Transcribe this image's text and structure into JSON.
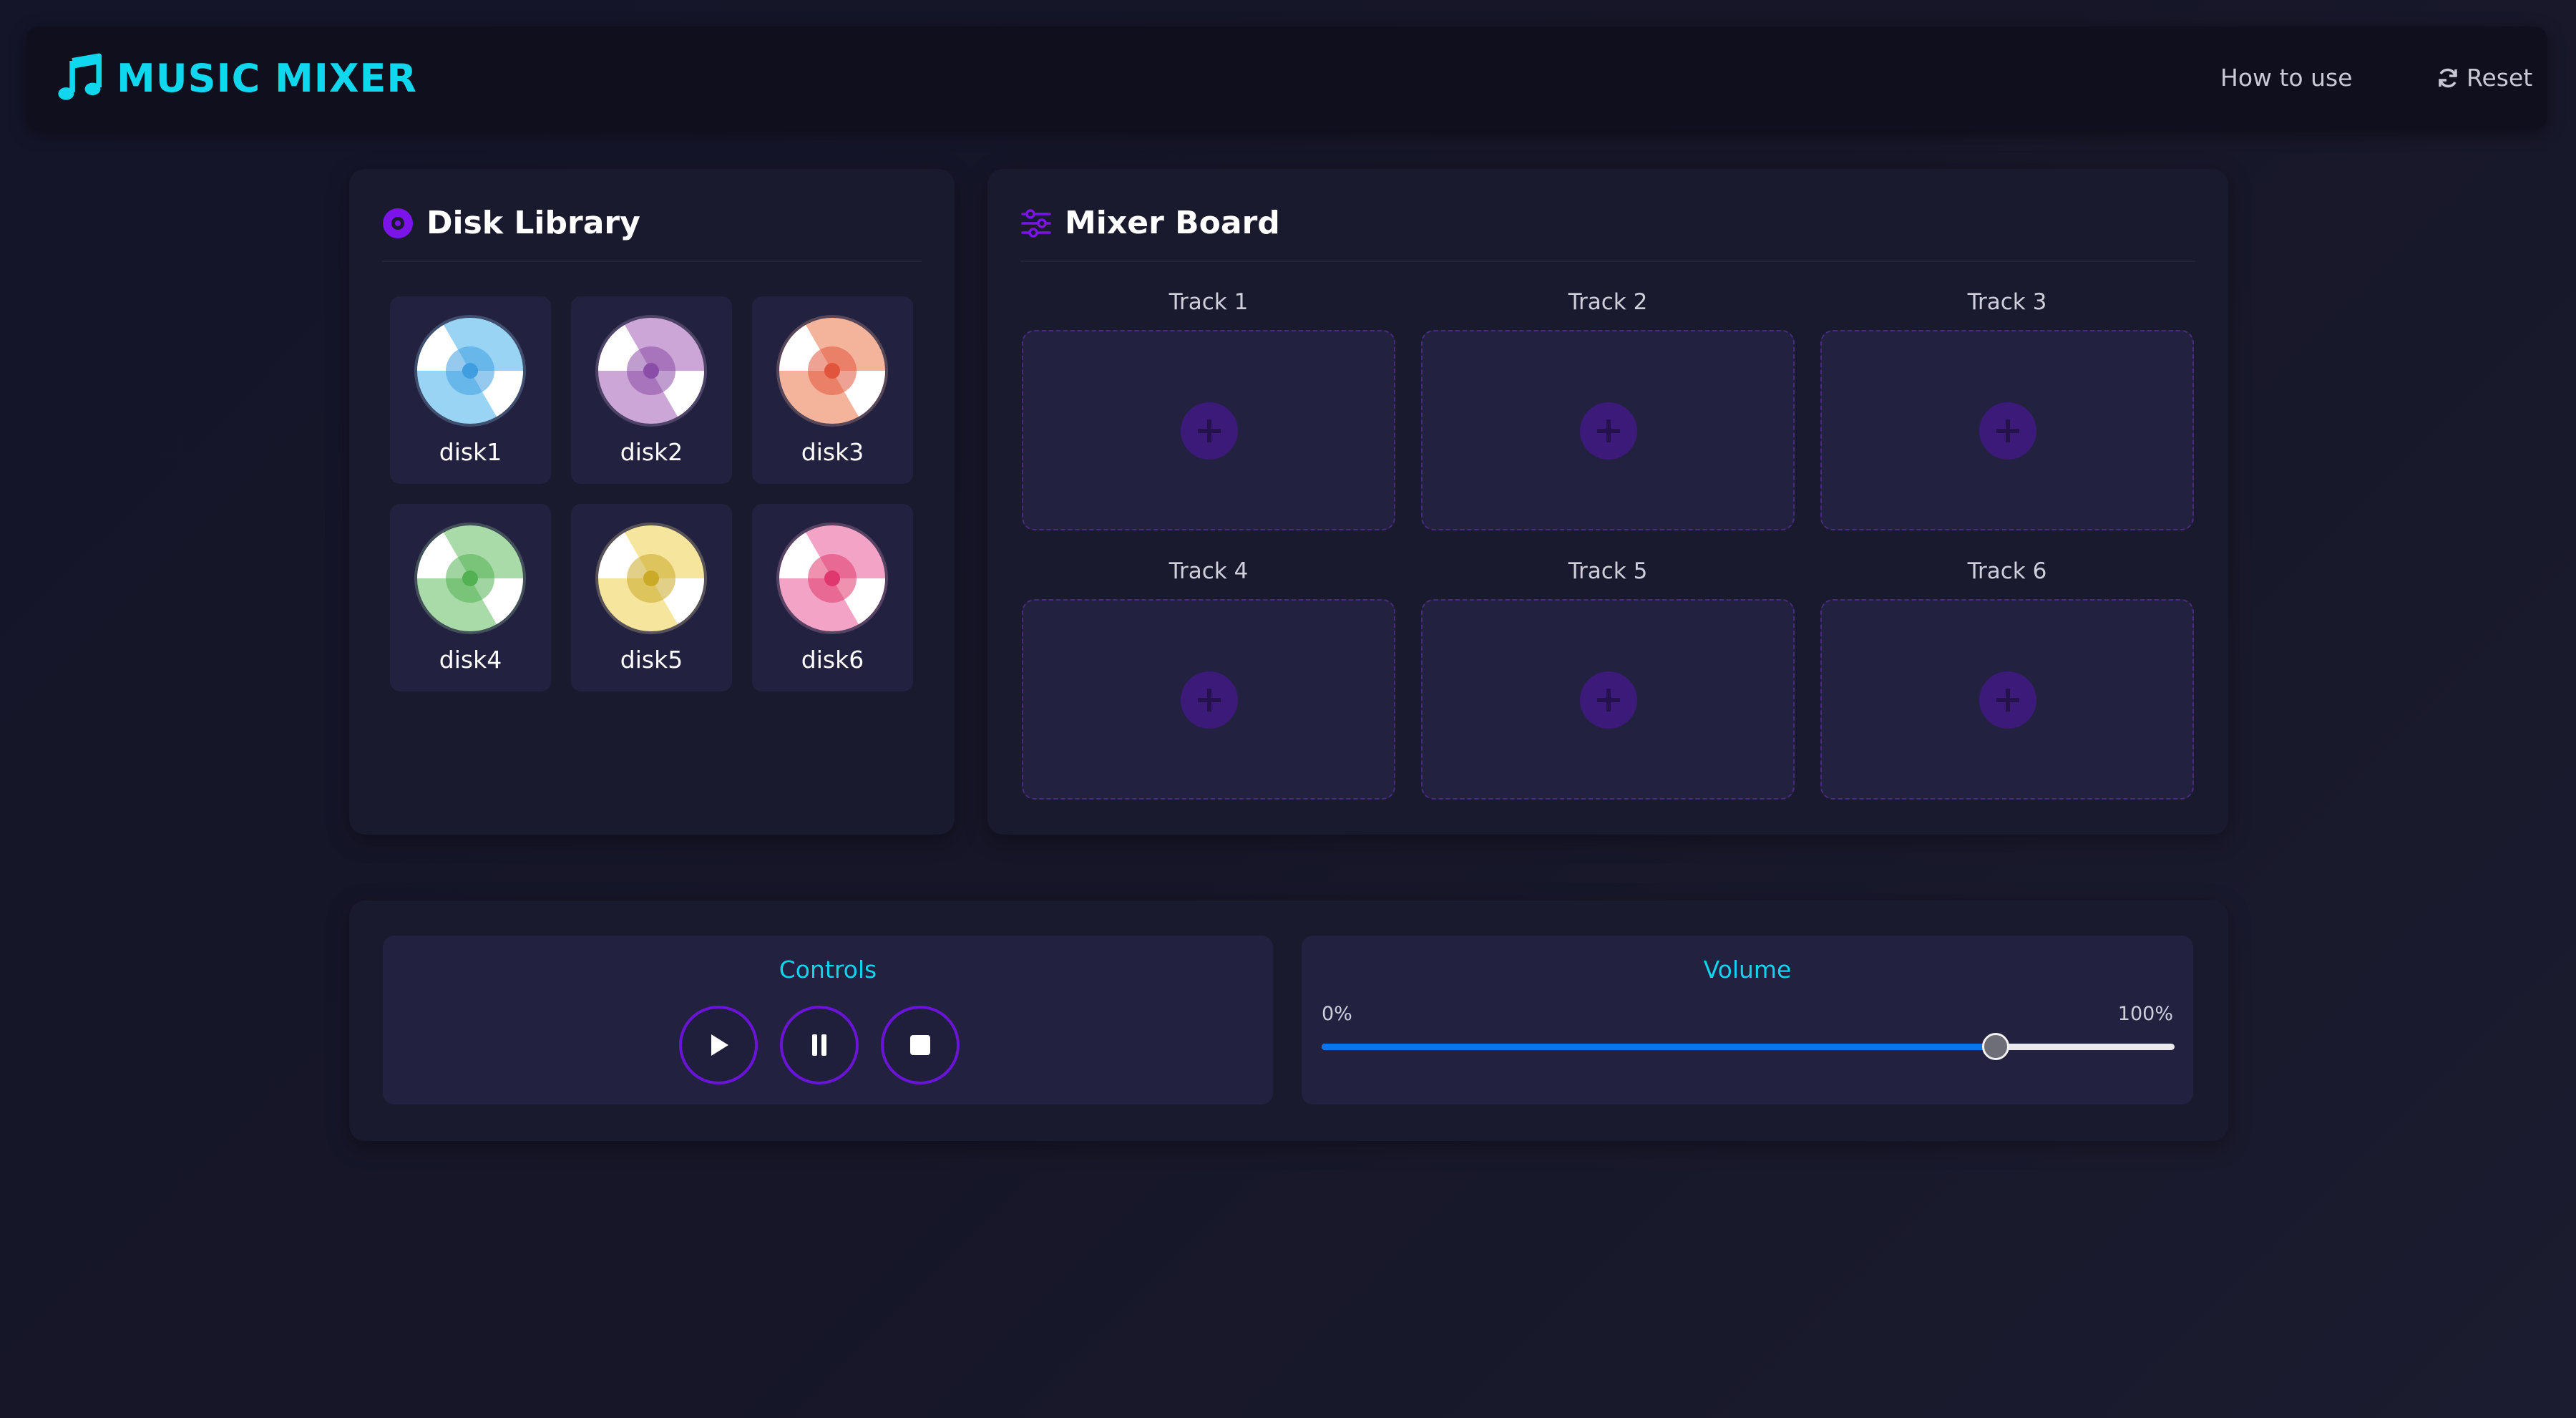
{
  "header": {
    "title": "MUSIC MIXER",
    "how_to_use": "How to use",
    "reset": "Reset"
  },
  "library": {
    "title": "Disk Library",
    "disks": [
      {
        "name": "disk1",
        "color": "#9ad4f5",
        "center": "#3e9ee0"
      },
      {
        "name": "disk2",
        "color": "#cca6d6",
        "center": "#8a4da8"
      },
      {
        "name": "disk3",
        "color": "#f4b49c",
        "center": "#e0553c"
      },
      {
        "name": "disk4",
        "color": "#a8dba8",
        "center": "#52b152"
      },
      {
        "name": "disk5",
        "color": "#f6e59c",
        "center": "#cbaa28"
      },
      {
        "name": "disk6",
        "color": "#f3a4c6",
        "center": "#e0386e"
      }
    ]
  },
  "mixer": {
    "title": "Mixer Board",
    "tracks": [
      "Track 1",
      "Track 2",
      "Track 3",
      "Track 4",
      "Track 5",
      "Track 6"
    ]
  },
  "controls": {
    "title": "Controls",
    "buttons": [
      "play",
      "pause",
      "stop"
    ]
  },
  "volume": {
    "title": "Volume",
    "min_label": "0%",
    "max_label": "100%",
    "level": 0.79
  },
  "colors": {
    "accent": "#0fd8ee",
    "purple": "#6a14d8",
    "slider_fill": "#0a74e8"
  }
}
